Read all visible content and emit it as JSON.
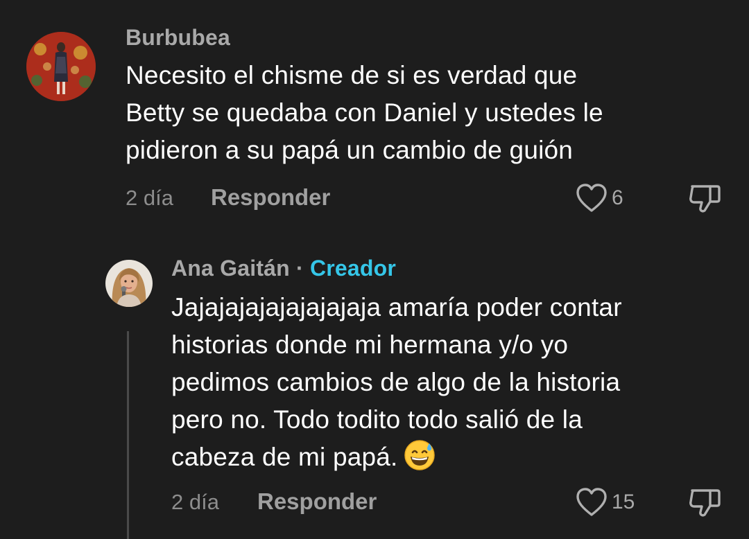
{
  "comments": [
    {
      "username": "Burbubea",
      "lines": [
        "Necesito el chisme de si es verdad que",
        "Betty se quedaba con Daniel y ustedes le",
        "pidieron a su papá un cambio de guión"
      ],
      "time": "2 día",
      "reply_label": "Responder",
      "likes": "6"
    }
  ],
  "reply": {
    "username": "Ana Gaitán",
    "separator": "·",
    "badge": "Creador",
    "lines": [
      "Jajajajajajajajajaja amaría poder contar",
      "historias donde mi hermana y/o yo",
      "pedimos cambios de algo de la historia",
      "pero no. Todo todito todo salió de la",
      "cabeza de mi papá."
    ],
    "emoji": "grinning-face-with-sweat-emoji",
    "time": "2 día",
    "reply_label": "Responder",
    "likes": "15"
  },
  "icons": {
    "like": "heart-icon",
    "dislike": "thumbs-down-icon"
  },
  "colors": {
    "background": "#1d1d1d",
    "creator_badge": "#35c6e8",
    "muted_text": "#a9a9a9"
  }
}
